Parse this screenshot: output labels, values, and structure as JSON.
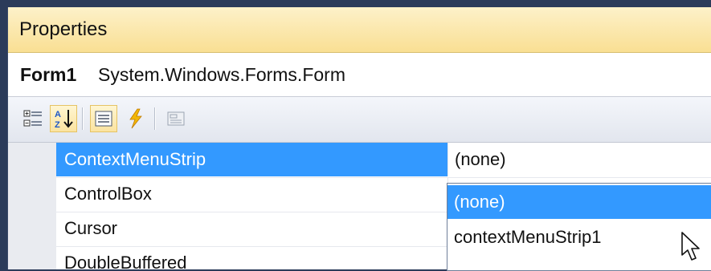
{
  "panel": {
    "title": "Properties"
  },
  "object_selector": {
    "name": "Form1",
    "type": "System.Windows.Forms.Form"
  },
  "toolbar": {
    "buttons": [
      {
        "icon": "categorized-icon",
        "active": false
      },
      {
        "icon": "alphabetical-sort-icon",
        "active": true
      },
      {
        "icon": "properties-icon",
        "active": true
      },
      {
        "icon": "events-lightning-icon",
        "active": false
      },
      {
        "icon": "property-pages-icon",
        "active": false
      }
    ]
  },
  "properties": [
    {
      "name": "ContextMenuStrip",
      "value": "(none)",
      "selected": true
    },
    {
      "name": "ControlBox",
      "value": ""
    },
    {
      "name": "Cursor",
      "value": ""
    },
    {
      "name": "DoubleBuffered",
      "value": ""
    }
  ],
  "dropdown": {
    "options": [
      "(none)",
      "contextMenuStrip1"
    ],
    "highlighted_index": 0
  },
  "colors": {
    "selection": "#3399ff",
    "title_bar": "#f9df93"
  }
}
